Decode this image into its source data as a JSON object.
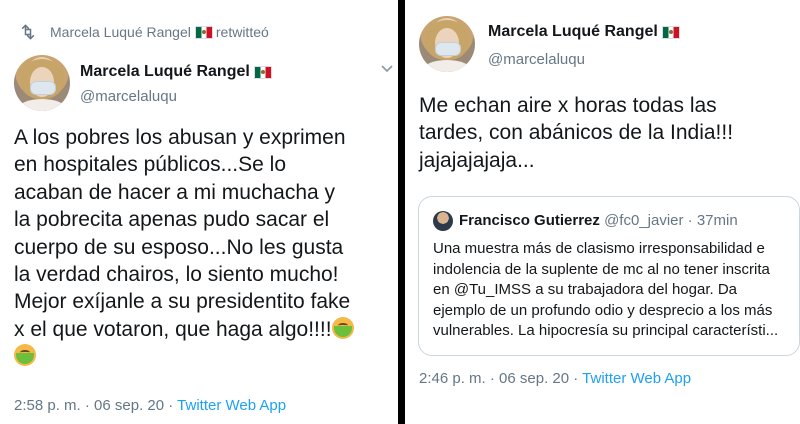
{
  "left_tweet": {
    "retweet_label": "Marcela Luqué Rangel",
    "retweet_suffix": "retwitteó",
    "author_name": "Marcela Luqué Rangel",
    "author_handle": "@marcelaluqu",
    "text_lines": [
      "A los pobres los abusan y exprimen",
      "en hospitales públicos...Se lo",
      "acaban de hacer a mi muchacha y",
      "la pobrecita apenas pudo sacar el",
      "cuerpo de su esposo...No les gusta",
      "la verdad chairos, lo siento mucho!",
      "Mejor exíjanle a su presidentito fake",
      "x el que votaron, que haga algo!!!!"
    ],
    "time": "2:58 p. m. · 06 sep. 20 ·",
    "source": "Twitter Web App"
  },
  "right_tweet": {
    "author_name": "Marcela Luqué Rangel",
    "author_handle": "@marcelaluqu",
    "text_lines": [
      "Me echan aire x horas todas las",
      "tardes, con abánicos de la India!!!",
      "jajajajajaja..."
    ],
    "quoted": {
      "author_name": "Francisco Gutierrez",
      "author_handle": "@fc0_javier",
      "time": "· 37min",
      "text_lines": [
        "Una muestra más de clasismo irresponsabilidad e",
        "indolencia de la suplente de mc al no tener inscrita",
        "en @Tu_IMSS a su trabajadora del hogar. Da",
        "ejemplo de un profundo odio y desprecio a los más",
        "vulnerables. La hipocresía su principal característi..."
      ]
    },
    "time": "2:46 p. m. · 06 sep. 20 ·",
    "source": "Twitter Web App"
  },
  "icons": {
    "retweet": "retweet-icon",
    "chevron": "chevron-down-icon",
    "flag": "mexico-flag-icon",
    "emoji": "nauseated-face-emoji"
  },
  "colors": {
    "text": "#14171a",
    "secondary": "#657786",
    "link": "#1da1f2",
    "divider": "#000000"
  }
}
